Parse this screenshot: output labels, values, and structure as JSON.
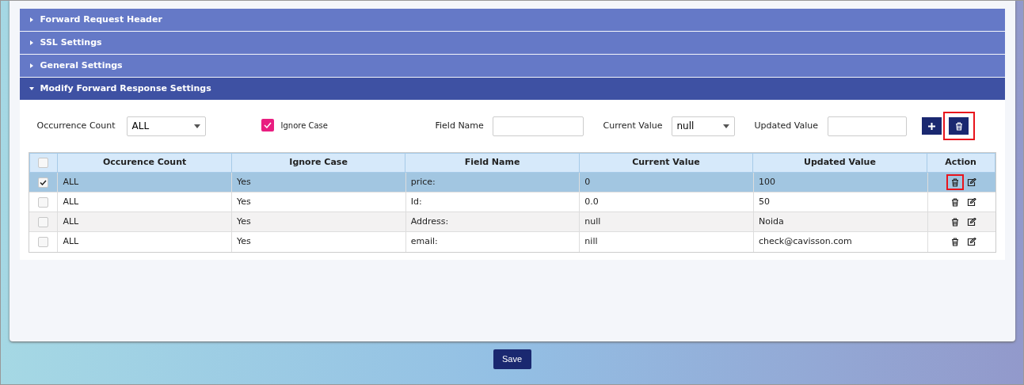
{
  "accordion": [
    {
      "title": "Forward Request Header",
      "expanded": false
    },
    {
      "title": "SSL Settings",
      "expanded": false
    },
    {
      "title": "General Settings",
      "expanded": false
    },
    {
      "title": "Modify Forward Response Settings",
      "expanded": true
    }
  ],
  "form": {
    "occurrence_label": "Occurrence Count",
    "occurrence_value": "ALL",
    "ignore_case": {
      "label": "Ignore Case",
      "checked": true
    },
    "field_name_label": "Field Name",
    "current_value_label": "Current Value",
    "current_value": "null",
    "updated_value_label": "Updated Value",
    "delete_highlighted": true
  },
  "table": {
    "all_checked": false,
    "columns": [
      "Occurence Count",
      "Ignore Case",
      "Field Name",
      "Current Value",
      "Updated Value",
      "Action"
    ],
    "rows": [
      {
        "cells": [
          "ALL",
          "Yes",
          "price:",
          "0",
          "100"
        ],
        "selected": true,
        "delete_highlighted": true
      },
      {
        "cells": [
          "ALL",
          "Yes",
          "Id:",
          "0.0",
          "50"
        ],
        "selected": false,
        "delete_highlighted": false
      },
      {
        "cells": [
          "ALL",
          "Yes",
          "Address:",
          "null",
          "Noida"
        ],
        "selected": false,
        "delete_highlighted": false
      },
      {
        "cells": [
          "ALL",
          "Yes",
          "email:",
          "nill",
          "check@cavisson.com"
        ],
        "selected": false,
        "delete_highlighted": false
      }
    ]
  },
  "save_button": "Save"
}
